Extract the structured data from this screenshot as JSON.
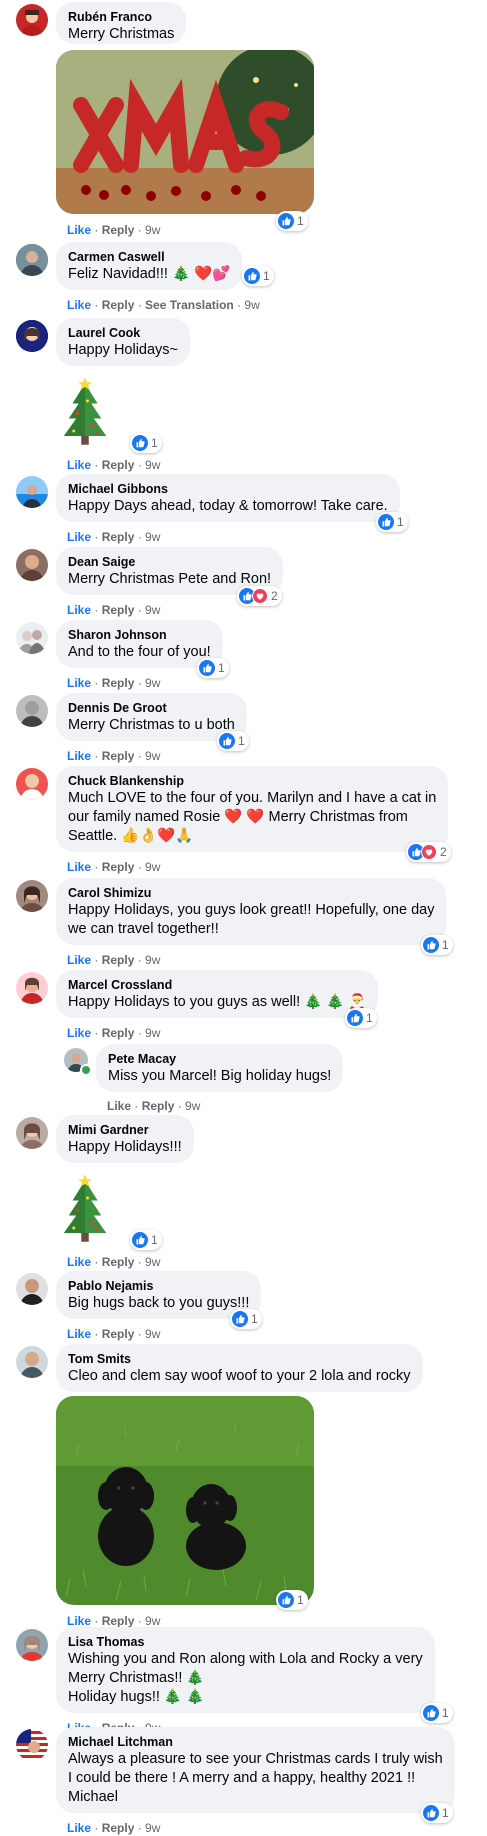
{
  "actions": {
    "like": "Like",
    "reply": "Reply",
    "translate": "See Translation",
    "time": "9w"
  },
  "comments": [
    {
      "author": "Rubén Franco",
      "text": "Merry Christmas",
      "reactions": "1"
    },
    {
      "author": "Carmen Caswell",
      "text": "Feliz Navidad!!! 🎄 ❤️💕",
      "reactions": "1"
    },
    {
      "author": "Laurel Cook",
      "text": "Happy Holidays~",
      "reactions": "1"
    },
    {
      "author": "Michael Gibbons",
      "text": "Happy Days ahead, today & tomorrow! Take care.",
      "reactions": "1"
    },
    {
      "author": "Dean Saige",
      "text": "Merry Christmas Pete and Ron!",
      "reactions": "2"
    },
    {
      "author": "Sharon Johnson",
      "text": "And to the four of you!",
      "reactions": "1"
    },
    {
      "author": "Dennis De Groot",
      "text": "Merry Christmas to u both",
      "reactions": "1"
    },
    {
      "author": "Chuck Blankenship",
      "text1": "Much LOVE to the four of you. Marilyn and I have a cat in",
      "text2": "our family named Rosie ❤️ ❤️ Merry Christmas from",
      "text3": "Seattle. 👍👌❤️🙏",
      "reactions": "2"
    },
    {
      "author": "Carol Shimizu",
      "text1": "Happy Holidays, you guys look great!! Hopefully, one day",
      "text2": "we can travel together!!",
      "reactions": "1"
    },
    {
      "author": "Marcel Crossland",
      "text": "Happy Holidays to you guys as well! 🎄 🎄 🎅",
      "reactions": "1"
    },
    {
      "author": "Pete Macay",
      "text": "Miss you Marcel! Big holiday hugs!"
    },
    {
      "author": "Mimi Gardner",
      "text": "Happy Holidays!!!",
      "reactions": "1"
    },
    {
      "author": "Pablo Nejamis",
      "text": "Big hugs back to you guys!!!",
      "reactions": "1"
    },
    {
      "author": "Tom Smits",
      "text": "Cleo and clem say woof woof to your 2 lola and rocky",
      "reactions": "1"
    },
    {
      "author": "Lisa Thomas",
      "text1": "Wishing you and Ron along with Lola and Rocky a very",
      "text2": "Merry Christmas!! 🎄",
      "text3": "Holiday hugs!! 🎄 🎄",
      "reactions": "1"
    },
    {
      "author": "Michael Litchman",
      "text1": "Always a pleasure to see your Christmas cards I truly wish",
      "text2": "I could be there ! A merry and a happy, healthy 2021 !!",
      "text3": "Michael",
      "reactions": "1"
    }
  ],
  "colors": {
    "like_blue": "#1877f2",
    "love_red": "#f33e58",
    "bubble_gray": "#f0f2f5"
  }
}
